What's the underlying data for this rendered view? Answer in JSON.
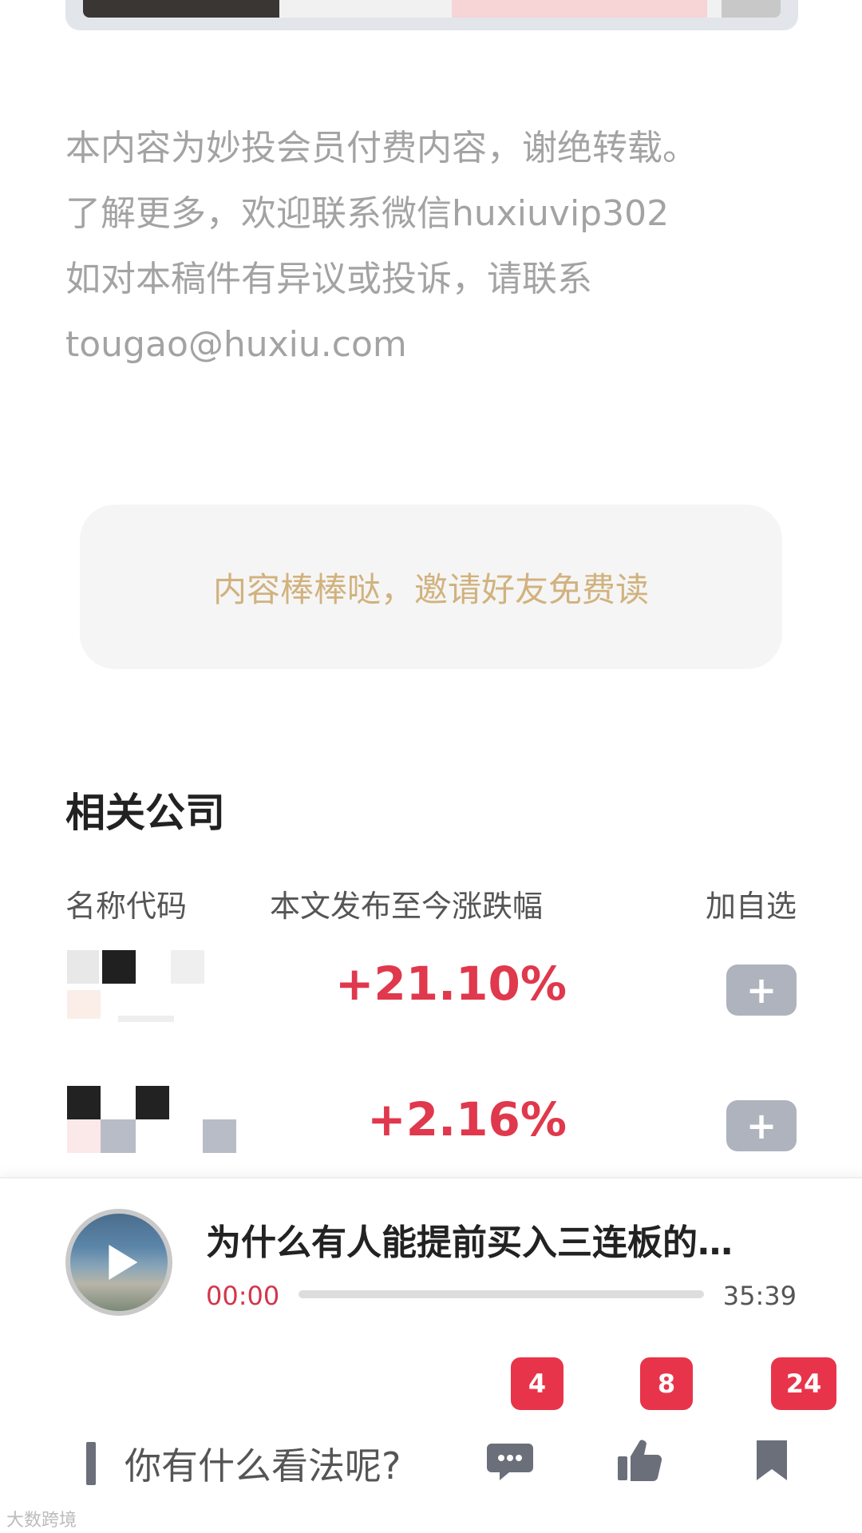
{
  "notice": {
    "line1": "本内容为妙投会员付费内容，谢绝转载。",
    "line2": "了解更多，欢迎联系微信huxiuvip302",
    "line3": "如对本稿件有异议或投诉，请联系",
    "line4": "tougao@huxiu.com"
  },
  "invite": {
    "label": "内容棒棒哒，邀请好友免费读"
  },
  "related": {
    "title": "相关公司",
    "headers": {
      "name": "名称代码",
      "change": "本文发布至今涨跌幅",
      "add": "加自选"
    },
    "rows": [
      {
        "change": "+21.10%",
        "add_icon": "+"
      },
      {
        "change": "+2.16%",
        "add_icon": "+"
      }
    ]
  },
  "player": {
    "title": "为什么有人能提前买入三连板的…",
    "current": "00:00",
    "total": "35:39",
    "progress": 0
  },
  "bottom_bar": {
    "comment_placeholder": "你有什么看法呢?",
    "comment_count": "4",
    "like_count": "8",
    "favorite_count": "24"
  },
  "watermark": "大数跨境",
  "colors": {
    "accent": "#e8344a",
    "gain": "#e0384c",
    "invite_text": "#d1b27e",
    "muted": "#a3a3a3"
  }
}
